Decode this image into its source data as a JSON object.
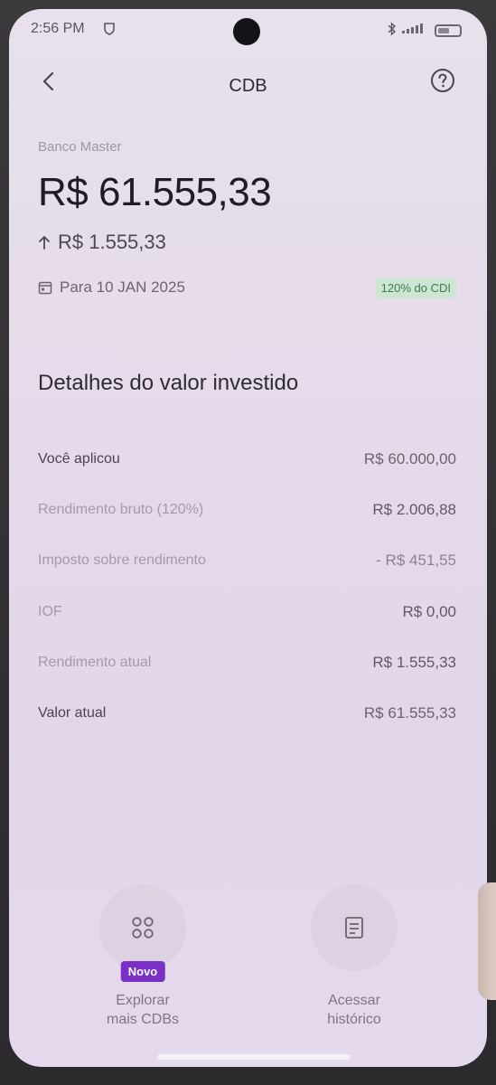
{
  "status_bar": {
    "time": "2:56 PM",
    "icons": [
      "shield-icon",
      "bluetooth-icon",
      "signal-icon",
      "battery-icon"
    ]
  },
  "header": {
    "title": "CDB",
    "back_icon": "chevron-left-icon",
    "help_icon": "question-circle-icon"
  },
  "summary": {
    "bank": "Banco Master",
    "balance": "R$ 61.555,33",
    "gain": "R$ 1.555,33",
    "gain_icon": "arrow-up-icon",
    "maturity": "Para 10 JAN 2025",
    "maturity_icon": "calendar-icon",
    "rate_badge": "120% do CDI"
  },
  "details": {
    "title": "Detalhes do valor investido",
    "rows": [
      {
        "label": "Você aplicou",
        "value": "R$ 60.000,00"
      },
      {
        "label": "Rendimento bruto (120%)",
        "value": "R$ 2.006,88"
      },
      {
        "label": "Imposto sobre rendimento",
        "value": "- R$ 451,55"
      },
      {
        "label": "IOF",
        "value": "R$ 0,00"
      },
      {
        "label": "Rendimento atual",
        "value": "R$ 1.555,33"
      },
      {
        "label": "Valor atual",
        "value": "R$ 61.555,33"
      }
    ]
  },
  "actions": {
    "explore": {
      "line1": "Explorar",
      "line2": "mais CDBs",
      "badge": "Novo",
      "icon": "grid-icon"
    },
    "history": {
      "line1": "Acessar",
      "line2": "histórico",
      "icon": "document-icon"
    }
  },
  "colors": {
    "background": "#e5dbea",
    "badge_green_bg": "#cde6d4",
    "badge_green_text": "#3d7a51",
    "brand_purple": "#7a2fc7"
  }
}
